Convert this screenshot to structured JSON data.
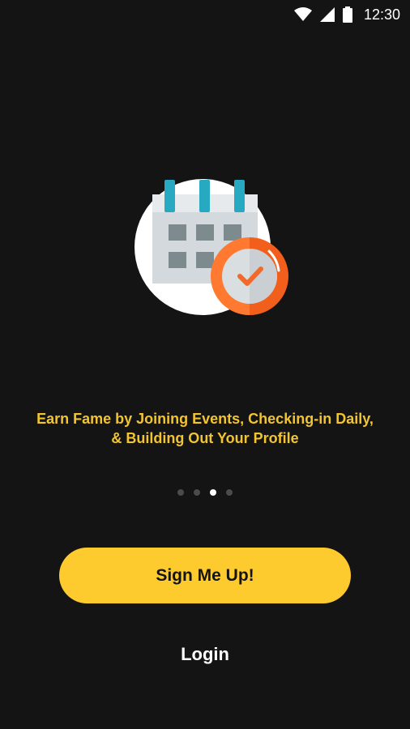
{
  "status_bar": {
    "time": "12:30",
    "icons": [
      "wifi-icon",
      "signal-icon",
      "battery-icon"
    ]
  },
  "onboarding": {
    "tagline": "Earn Fame by Joining Events, Checking-in Daily, & Building Out Your Profile",
    "page_count": 4,
    "active_page": 3
  },
  "actions": {
    "signup_label": "Sign Me Up!",
    "login_label": "Login"
  },
  "colors": {
    "background": "#141414",
    "accent": "#FDCB2E",
    "tagline": "#F2C530",
    "badge": "#FF6F2B"
  }
}
